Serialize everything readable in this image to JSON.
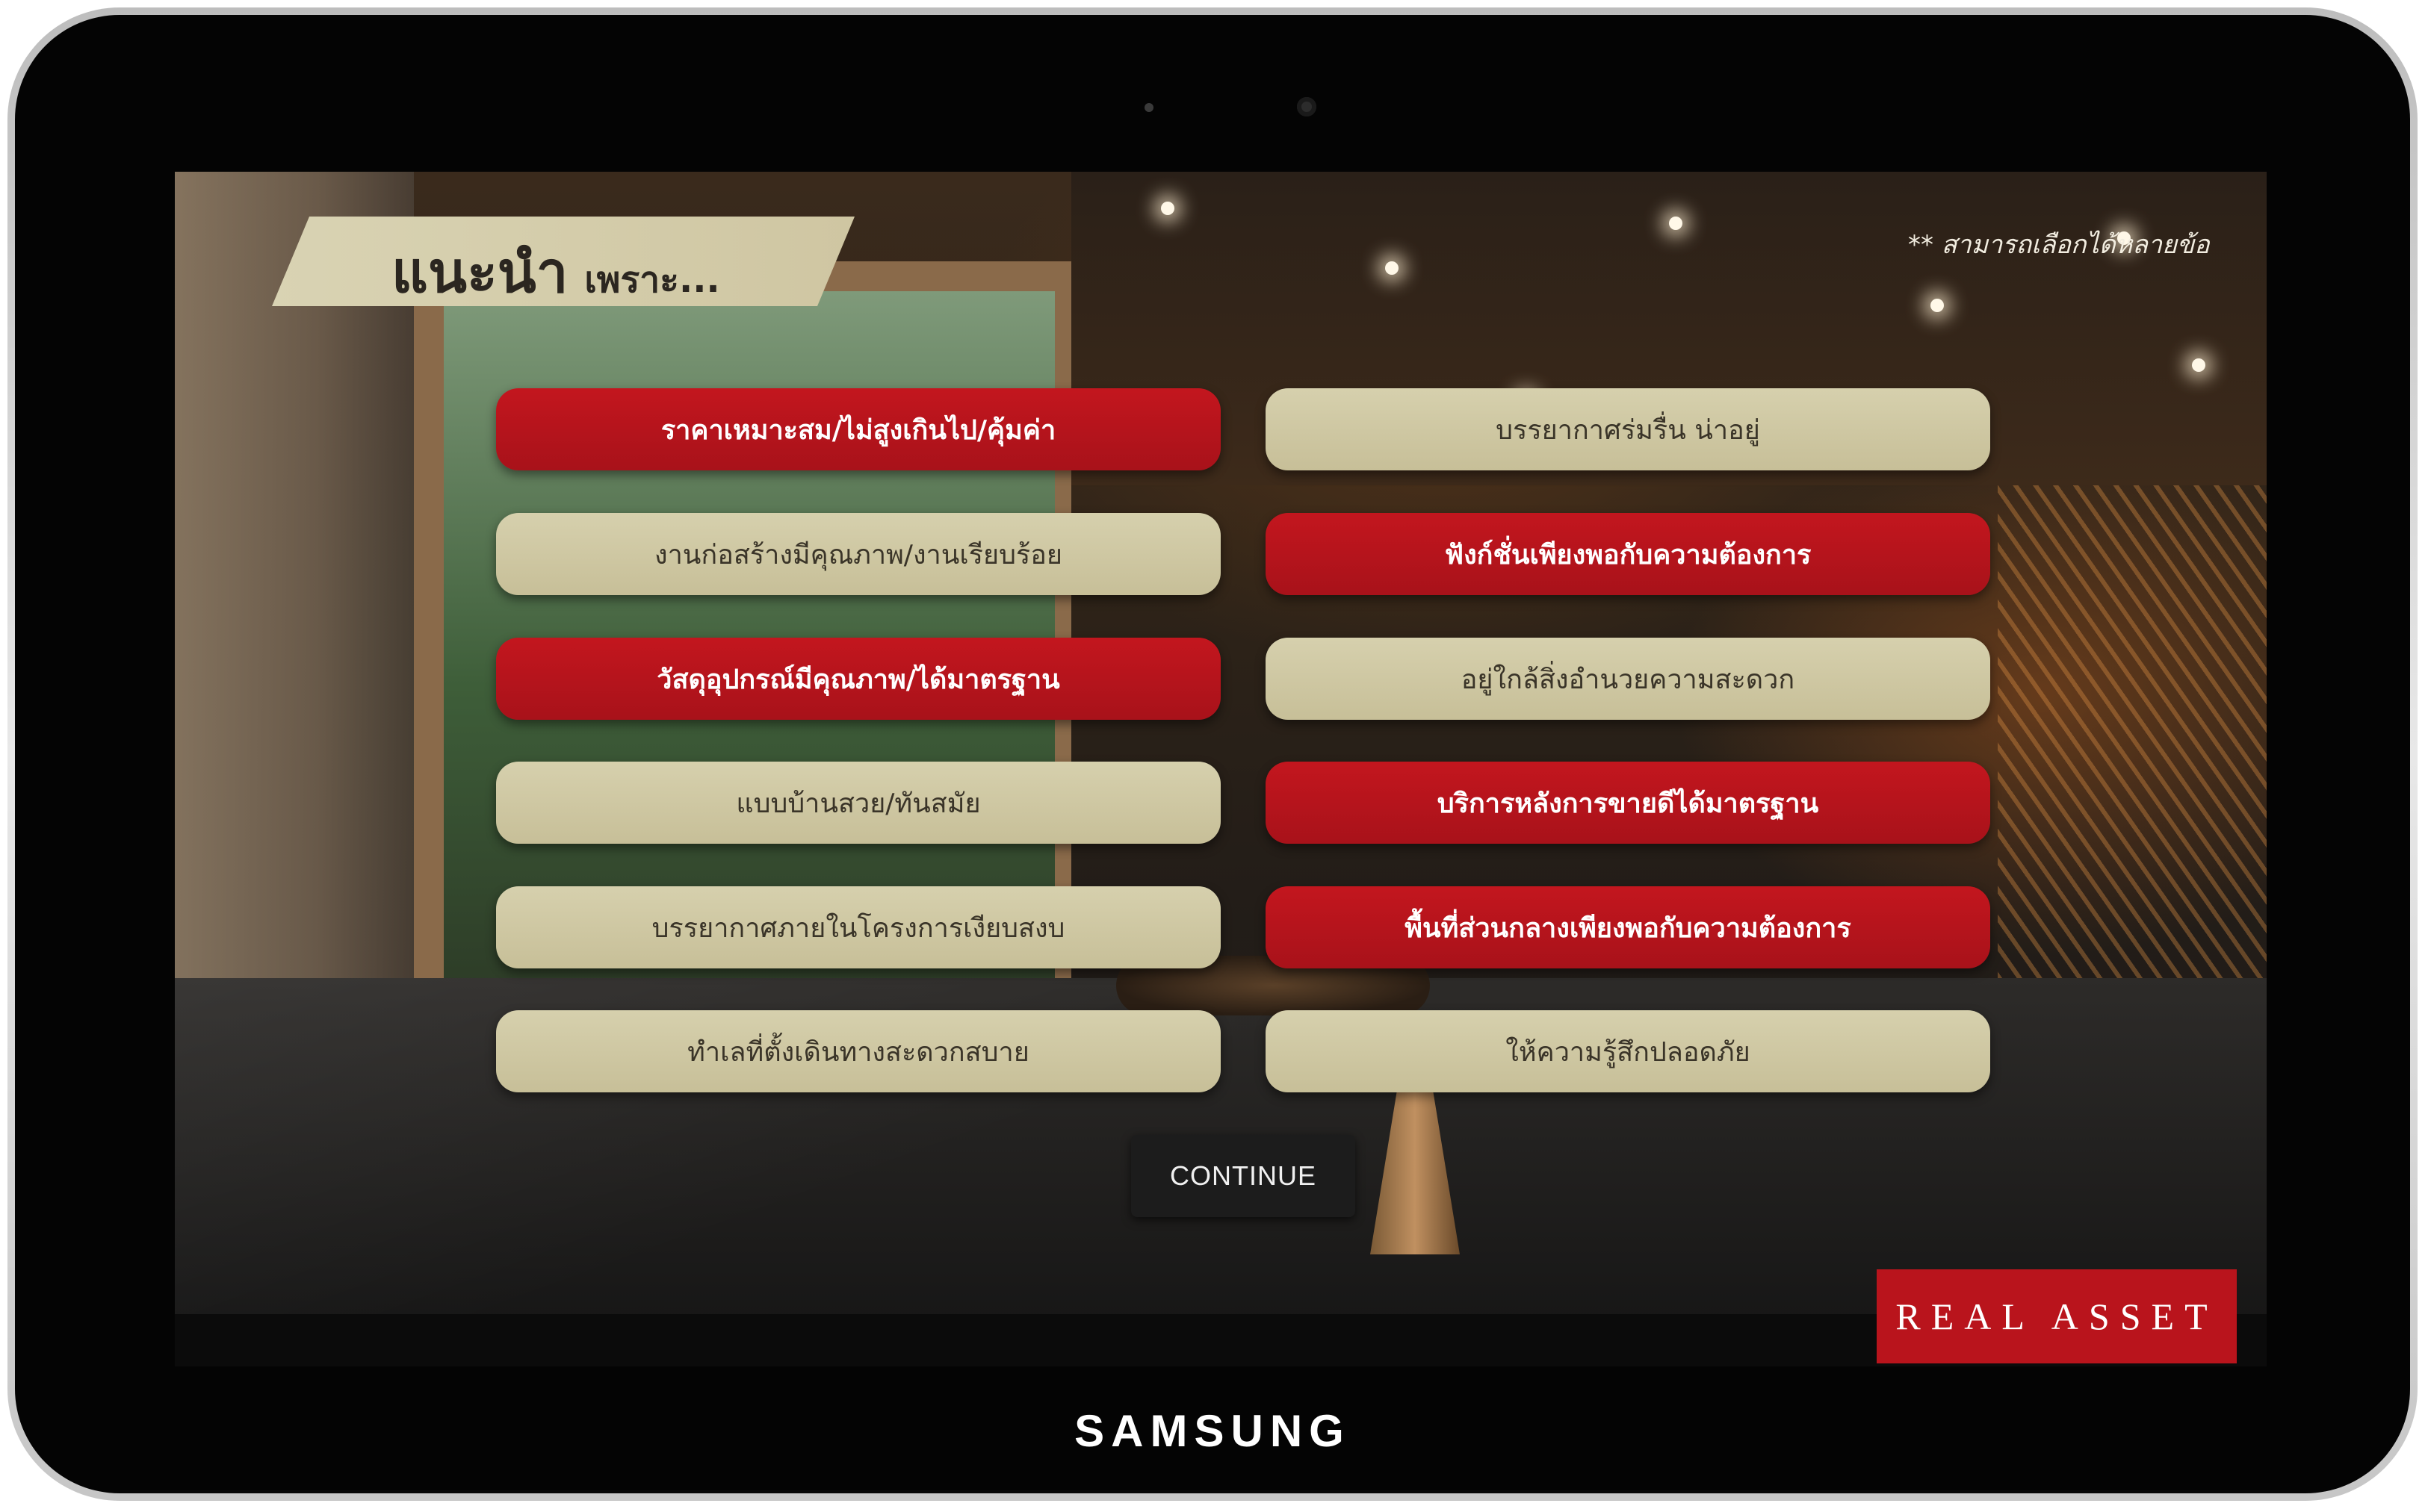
{
  "device": {
    "brand": "SAMSUNG"
  },
  "header": {
    "title_main": "แนะนำ",
    "title_sub": "เพราะ...",
    "note": "** สามารถเลือกได้หลายข้อ"
  },
  "options": {
    "left": [
      {
        "label": "ราคาเหมาะสม/ไม่สูงเกินไป/คุ้มค่า",
        "selected": true
      },
      {
        "label": "งานก่อสร้างมีคุณภาพ/งานเรียบร้อย",
        "selected": false
      },
      {
        "label": "วัสดุอุปกรณ์มีคุณภาพ/ได้มาตรฐาน",
        "selected": true
      },
      {
        "label": "แบบบ้านสวย/ทันสมัย",
        "selected": false
      },
      {
        "label": "บรรยากาศภายในโครงการเงียบสงบ",
        "selected": false
      },
      {
        "label": "ทำเลที่ตั้งเดินทางสะดวกสบาย",
        "selected": false
      }
    ],
    "right": [
      {
        "label": "บรรยากาศร่มรื่น น่าอยู่",
        "selected": false
      },
      {
        "label": "ฟังก์ชั่นเพียงพอกับความต้องการ",
        "selected": true
      },
      {
        "label": "อยู่ใกล้สิ่งอำนวยความสะดวก",
        "selected": false
      },
      {
        "label": "บริการหลังการขายดีได้มาตรฐาน",
        "selected": true
      },
      {
        "label": "พื้นที่ส่วนกลางเพียงพอกับความต้องการ",
        "selected": true
      },
      {
        "label": "ให้ความรู้สึกปลอดภัย",
        "selected": false
      }
    ]
  },
  "continue_label": "CONTINUE",
  "logo_text": "REAL ASSET",
  "colors": {
    "selected": "#b8141c",
    "neutral": "#cfc8a3",
    "banner": "#d4cdac"
  }
}
